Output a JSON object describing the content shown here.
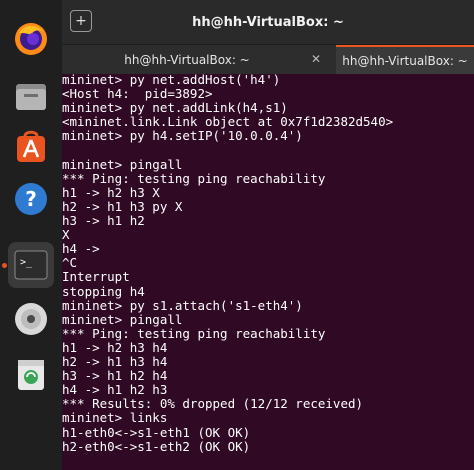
{
  "window": {
    "title": "hh@hh-VirtualBox: ~",
    "new_tab_glyph": "+"
  },
  "tabs": [
    {
      "label": "hh@hh-VirtualBox: ~"
    },
    {
      "label": "hh@hh-VirtualBox: ~"
    }
  ],
  "dock": {
    "items": [
      "firefox-icon",
      "files-icon",
      "app-store-icon",
      "help-icon",
      "terminal-icon",
      "optical-disc-icon",
      "trash-icon"
    ],
    "accent": "#e95420"
  },
  "terminal": {
    "lines": [
      "mininet> py net.addHost('h4')",
      "<Host h4:  pid=3892>",
      "mininet> py net.addLink(h4,s1)",
      "<mininet.link.Link object at 0x7f1d2382d540>",
      "mininet> py h4.setIP('10.0.0.4')",
      "",
      "mininet> pingall",
      "*** Ping: testing ping reachability",
      "h1 -> h2 h3 X",
      "h2 -> h1 h3 py X",
      "h3 -> h1 h2",
      "X",
      "h4 ->",
      "^C",
      "Interrupt",
      "stopping h4",
      "mininet> py s1.attach('s1-eth4')",
      "mininet> pingall",
      "*** Ping: testing ping reachability",
      "h1 -> h2 h3 h4",
      "h2 -> h1 h3 h4",
      "h3 -> h1 h2 h4",
      "h4 -> h1 h2 h3",
      "*** Results: 0% dropped (12/12 received)",
      "mininet> links",
      "h1-eth0<->s1-eth1 (OK OK)",
      "h2-eth0<->s1-eth2 (OK OK)"
    ],
    "background": "#300a24",
    "foreground": "#ffffff"
  }
}
